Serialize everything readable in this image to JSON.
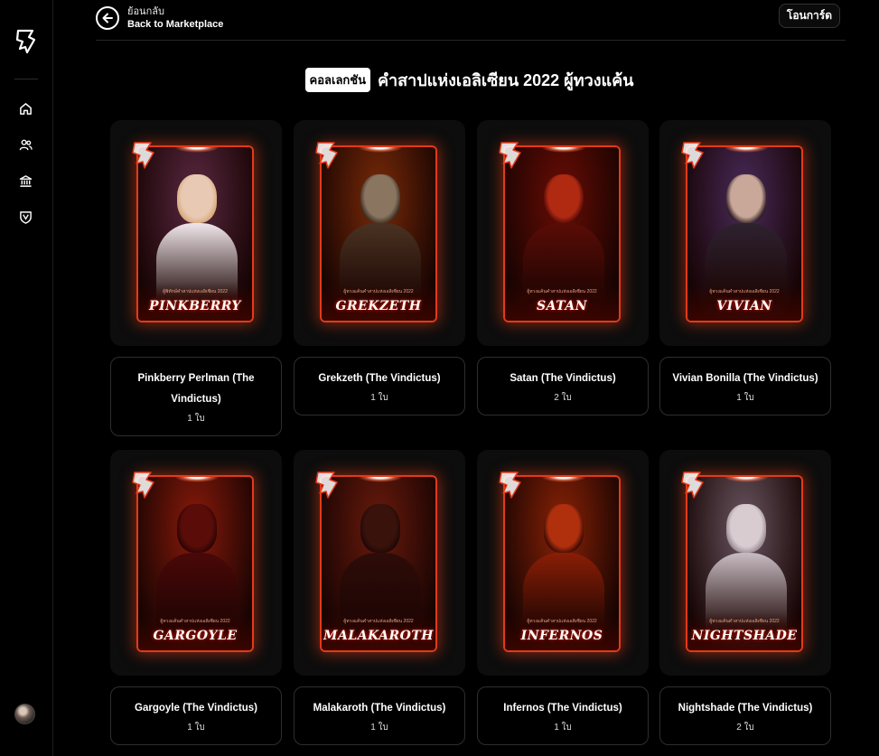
{
  "sidebar": {
    "logo": "bp-logo-icon",
    "nav": [
      {
        "icon": "home-icon"
      },
      {
        "icon": "users-icon"
      },
      {
        "icon": "bank-icon"
      },
      {
        "icon": "shield-icon"
      }
    ]
  },
  "topbar": {
    "back_th": "ย้อนกลับ",
    "back_en": "Back to Marketplace",
    "transfer": "โอนการ์ด"
  },
  "collection": {
    "pill": "คอลเลกชัน",
    "title": "คำสาปแห่งเอลิเซียน 2022 ผู้ทวงแค้น"
  },
  "cards": [
    {
      "name": "PINKBERRY",
      "sub": "ผู้พิทักษ์คำสาปแห่งเอลิเซียน 2022",
      "title": "Pinkberry Perlman (The Vindictus)",
      "count": "1 ใบ",
      "bg": "#5a2840",
      "skin": "#e8c9b4",
      "hair": "#d7a878",
      "body": "#f0e6ea"
    },
    {
      "name": "GREKZETH",
      "sub": "ผู้ทวงแค้นคำสาปแห่งเอลิเซียน 2022",
      "title": "Grekzeth (The Vindictus)",
      "count": "1 ใบ",
      "bg": "#7a2a08",
      "skin": "#8a7560",
      "hair": "#3a2a1e",
      "body": "#4a3222"
    },
    {
      "name": "SATAN",
      "sub": "ผู้ทวงแค้นคำสาปแห่งเอลิเซียน 2022",
      "title": "Satan (The Vindictus)",
      "count": "2 ใบ",
      "bg": "#6a0c04",
      "skin": "#b02a12",
      "hair": "#4a0804",
      "body": "#5a0c06"
    },
    {
      "name": "VIVIAN",
      "sub": "ผู้ทวงแค้นคำสาปแห่งเอลิเซียน 2022",
      "title": "Vivian Bonilla (The Vindictus)",
      "count": "1 ใบ",
      "bg": "#4a2a5a",
      "skin": "#c9a89a",
      "hair": "#2a1a1e",
      "body": "#2e2230"
    },
    {
      "name": "GARGOYLE",
      "sub": "ผู้ทวงแค้นคำสาปแห่งเอลิเซียน 2022",
      "title": "Gargoyle (The Vindictus)",
      "count": "1 ใบ",
      "bg": "#8a1a0a",
      "skin": "#5a0c08",
      "hair": "#2a0404",
      "body": "#4a0808"
    },
    {
      "name": "MALAKAROTH",
      "sub": "ผู้ทวงแค้นคำสาปแห่งเอลิเซียน 2022",
      "title": "Malakaroth (The Vindictus)",
      "count": "1 ใบ",
      "bg": "#6a1a0c",
      "skin": "#3a120c",
      "hair": "#1e0806",
      "body": "#2e0c08"
    },
    {
      "name": "INFERNOS",
      "sub": "ผู้ทวงแค้นคำสาปแห่งเอลิเซียน 2022",
      "title": "Infernos (The Vindictus)",
      "count": "1 ใบ",
      "bg": "#8a2206",
      "skin": "#b0300e",
      "hair": "#3a0a02",
      "body": "#8a1e06"
    },
    {
      "name": "NIGHTSHADE",
      "sub": "ผู้ทวงแค้นคำสาปแห่งเอลิเซียน 2022",
      "title": "Nightshade (The Vindictus)",
      "count": "2 ใบ",
      "bg": "#6a5560",
      "skin": "#d8ccd0",
      "hair": "#9a8a92",
      "body": "#c8bcc2"
    }
  ]
}
